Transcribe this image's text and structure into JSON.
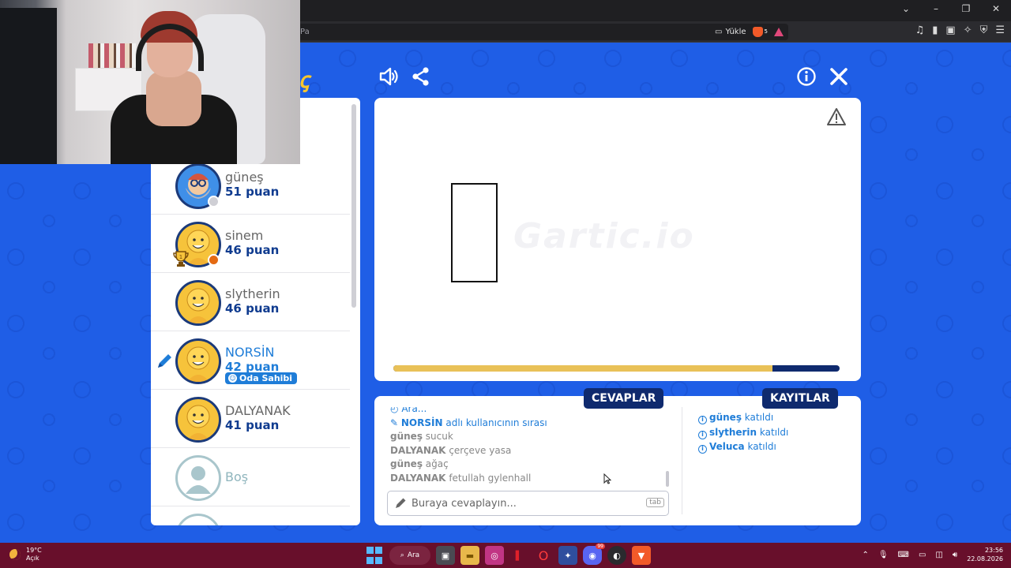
{
  "browser": {
    "url_fragment": "Pa",
    "upload_label": "Yükle",
    "brave_badge": "5"
  },
  "players": [
    {
      "name": "güneş",
      "score": "51 puan",
      "status_color": "#cfcfd5"
    },
    {
      "name": "sinem",
      "score": "46 puan",
      "status_color": "#e46a12"
    },
    {
      "name": "slytherin",
      "score": "46 puan",
      "status_color": ""
    },
    {
      "name": "NORSİN",
      "score": "42 puan",
      "status_color": "",
      "badge": "Oda Sahibi"
    },
    {
      "name": "DALYANAK",
      "score": "41 puan",
      "status_color": ""
    },
    {
      "name": "Boş",
      "score": "",
      "status_color": ""
    }
  ],
  "drawing": {
    "progress": 0.85,
    "watermark": "Gartic.io"
  },
  "answers": {
    "tab_label": "CEVAPLAR",
    "lines": [
      {
        "who": "",
        "text": "Ara...",
        "system": true
      },
      {
        "who": "NORSİN",
        "text": "adlı kullanıcının sırası",
        "system": true
      },
      {
        "who": "güneş",
        "text": "sucuk",
        "system": false
      },
      {
        "who": "DALYANAK",
        "text": "çerçeve yasa",
        "system": false
      },
      {
        "who": "güneş",
        "text": "ağaç",
        "system": false
      },
      {
        "who": "DALYANAK",
        "text": "fetullah gylenhall",
        "system": false
      }
    ],
    "input_placeholder": "Buraya cevaplayın...",
    "tab_hint": "tab"
  },
  "log": {
    "tab_label": "KAYITLAR",
    "lines": [
      {
        "who": "güneş",
        "text": "katıldı"
      },
      {
        "who": "slytherin",
        "text": "katıldı"
      },
      {
        "who": "Veluca",
        "text": "katıldı"
      }
    ]
  },
  "taskbar": {
    "temp": "19°C",
    "weather": "Açık",
    "search_label": "Ara",
    "discord_badge": "99",
    "time": "23:56",
    "date": "22.08.2026"
  },
  "colors": {
    "game_bg": "#1f5ee6",
    "navy": "#0f2a6e",
    "accent_blue": "#1f7dd8",
    "progress_gold": "#e9c158",
    "taskbar": "#680f2b"
  }
}
